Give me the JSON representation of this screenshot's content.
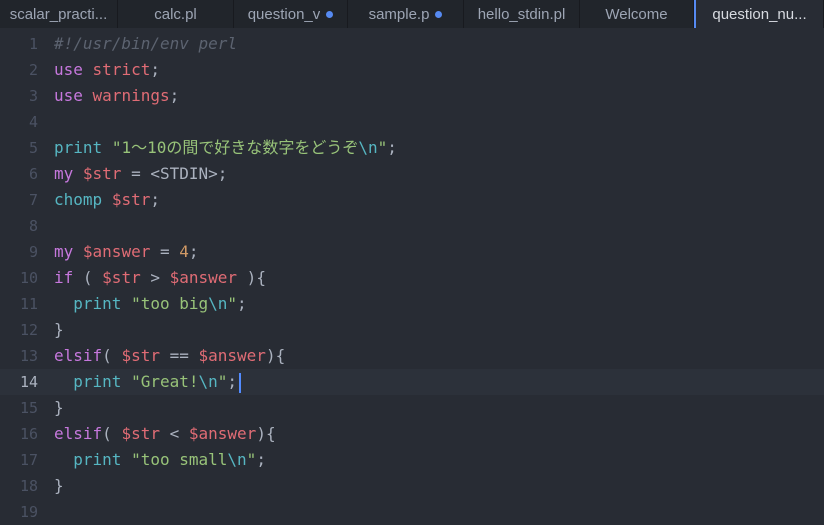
{
  "tabs": [
    {
      "label": "scalar_practi...",
      "modified": false,
      "active": false
    },
    {
      "label": "calc.pl",
      "modified": false,
      "active": false
    },
    {
      "label": "question_v",
      "modified": true,
      "active": false
    },
    {
      "label": "sample.p",
      "modified": true,
      "active": false
    },
    {
      "label": "hello_stdin.pl",
      "modified": false,
      "active": false
    },
    {
      "label": "Welcome",
      "modified": false,
      "active": false
    },
    {
      "label": "question_nu...",
      "modified": false,
      "active": true
    }
  ],
  "editor": {
    "current_line": 14,
    "lines": [
      {
        "n": "1",
        "tokens": [
          [
            "cmt",
            "#!/usr/bin/env perl"
          ]
        ]
      },
      {
        "n": "2",
        "tokens": [
          [
            "kw",
            "use"
          ],
          [
            "pun",
            " "
          ],
          [
            "var",
            "strict"
          ],
          [
            "pun",
            ";"
          ]
        ]
      },
      {
        "n": "3",
        "tokens": [
          [
            "kw",
            "use"
          ],
          [
            "pun",
            " "
          ],
          [
            "var",
            "warnings"
          ],
          [
            "pun",
            ";"
          ]
        ]
      },
      {
        "n": "4",
        "tokens": []
      },
      {
        "n": "5",
        "tokens": [
          [
            "fn",
            "print"
          ],
          [
            "pun",
            " "
          ],
          [
            "str",
            "\"1〜10の間で好きな数字をどうぞ"
          ],
          [
            "esc",
            "\\n"
          ],
          [
            "str",
            "\""
          ],
          [
            "pun",
            ";"
          ]
        ]
      },
      {
        "n": "6",
        "tokens": [
          [
            "kw",
            "my"
          ],
          [
            "pun",
            " "
          ],
          [
            "var",
            "$str"
          ],
          [
            "pun",
            " = <STDIN>;"
          ]
        ]
      },
      {
        "n": "7",
        "tokens": [
          [
            "fn",
            "chomp"
          ],
          [
            "pun",
            " "
          ],
          [
            "var",
            "$str"
          ],
          [
            "pun",
            ";"
          ]
        ]
      },
      {
        "n": "8",
        "tokens": []
      },
      {
        "n": "9",
        "tokens": [
          [
            "kw",
            "my"
          ],
          [
            "pun",
            " "
          ],
          [
            "var",
            "$answer"
          ],
          [
            "pun",
            " = "
          ],
          [
            "num",
            "4"
          ],
          [
            "pun",
            ";"
          ]
        ]
      },
      {
        "n": "10",
        "tokens": [
          [
            "kw",
            "if"
          ],
          [
            "pun",
            " ( "
          ],
          [
            "var",
            "$str"
          ],
          [
            "pun",
            " > "
          ],
          [
            "var",
            "$answer"
          ],
          [
            "pun",
            " ){"
          ]
        ]
      },
      {
        "n": "11",
        "tokens": [
          [
            "pun",
            "  "
          ],
          [
            "fn",
            "print"
          ],
          [
            "pun",
            " "
          ],
          [
            "str",
            "\"too big"
          ],
          [
            "esc",
            "\\n"
          ],
          [
            "str",
            "\""
          ],
          [
            "pun",
            ";"
          ]
        ]
      },
      {
        "n": "12",
        "tokens": [
          [
            "pun",
            "}"
          ]
        ]
      },
      {
        "n": "13",
        "tokens": [
          [
            "kw",
            "elsif"
          ],
          [
            "pun",
            "( "
          ],
          [
            "var",
            "$str"
          ],
          [
            "pun",
            " == "
          ],
          [
            "var",
            "$answer"
          ],
          [
            "pun",
            "){"
          ]
        ]
      },
      {
        "n": "14",
        "tokens": [
          [
            "pun",
            "  "
          ],
          [
            "fn",
            "print"
          ],
          [
            "pun",
            " "
          ],
          [
            "str",
            "\"Great!"
          ],
          [
            "esc",
            "\\n"
          ],
          [
            "str",
            "\""
          ],
          [
            "pun",
            ";"
          ]
        ]
      },
      {
        "n": "15",
        "tokens": [
          [
            "pun",
            "}"
          ]
        ]
      },
      {
        "n": "16",
        "tokens": [
          [
            "kw",
            "elsif"
          ],
          [
            "pun",
            "( "
          ],
          [
            "var",
            "$str"
          ],
          [
            "pun",
            " < "
          ],
          [
            "var",
            "$answer"
          ],
          [
            "pun",
            "){"
          ]
        ]
      },
      {
        "n": "17",
        "tokens": [
          [
            "pun",
            "  "
          ],
          [
            "fn",
            "print"
          ],
          [
            "pun",
            " "
          ],
          [
            "str",
            "\"too small"
          ],
          [
            "esc",
            "\\n"
          ],
          [
            "str",
            "\""
          ],
          [
            "pun",
            ";"
          ]
        ]
      },
      {
        "n": "18",
        "tokens": [
          [
            "pun",
            "}"
          ]
        ]
      },
      {
        "n": "19",
        "tokens": []
      }
    ]
  },
  "colors": {
    "background": "#282c34",
    "accent": "#568af2",
    "keyword": "#c678dd",
    "variable": "#e06c75",
    "string": "#98c379"
  }
}
